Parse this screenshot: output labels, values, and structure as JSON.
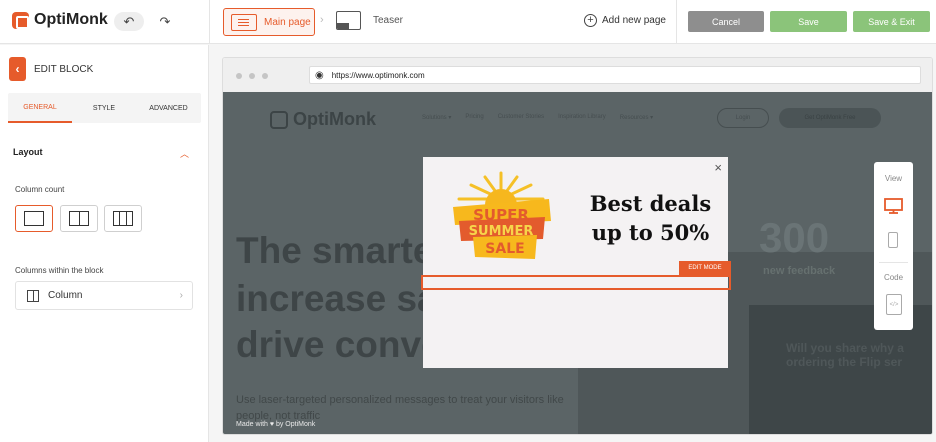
{
  "app": {
    "name": "OptiMonk"
  },
  "toolbar": {
    "undo_icon": "undo-icon",
    "redo_icon": "redo-icon",
    "main_page_label": "Main page",
    "teaser_label": "Teaser",
    "add_page_label": "Add new page",
    "cancel_label": "Cancel",
    "save_label": "Save",
    "save_exit_label": "Save & Exit"
  },
  "sidebar": {
    "title": "EDIT BLOCK",
    "tabs": [
      {
        "label": "GENERAL",
        "active": true
      },
      {
        "label": "STYLE",
        "active": false
      },
      {
        "label": "ADVANCED",
        "active": false
      }
    ],
    "section_title": "Layout",
    "column_count_label": "Column count",
    "column_count_options": [
      1,
      2,
      3
    ],
    "column_count_selected": 1,
    "columns_within_label": "Columns within the block",
    "column_item_label": "Column"
  },
  "browser": {
    "url": "https://www.optimonk.com"
  },
  "site": {
    "logo_text": "OptiMonk",
    "nav": [
      "Solutions ▾",
      "Pricing",
      "Customer Stories",
      "Inspiration Library",
      "Resources ▾"
    ],
    "login_label": "Login",
    "cta_label": "Get OptiMonk Free",
    "hero_lines": [
      "The smarte",
      "increase sa",
      "drive conve"
    ],
    "hero_sub": "Use laser-targeted personalized messages to treat your visitors like people, not traffic",
    "stat_number": "300",
    "stat_label": "new feedback",
    "card_text": "Will you share why a ordering the Flip ser",
    "made_with": "Made with ♥ by OptiMonk"
  },
  "popup": {
    "close_glyph": "×",
    "headline_line1": "Best deals",
    "headline_line2": "up to 50%",
    "badge_word1": "SUPER",
    "badge_word2": "SUMMER",
    "badge_word3": "SALE",
    "edit_mode_label": "EDIT MODE"
  },
  "device_panel": {
    "view_label": "View",
    "code_label": "Code",
    "active_device": "desktop"
  },
  "colors": {
    "accent": "#e65b2b",
    "save_green": "#8bc47a",
    "cancel_gray": "#8e8e8e",
    "site_overlay": "#5b6466"
  }
}
